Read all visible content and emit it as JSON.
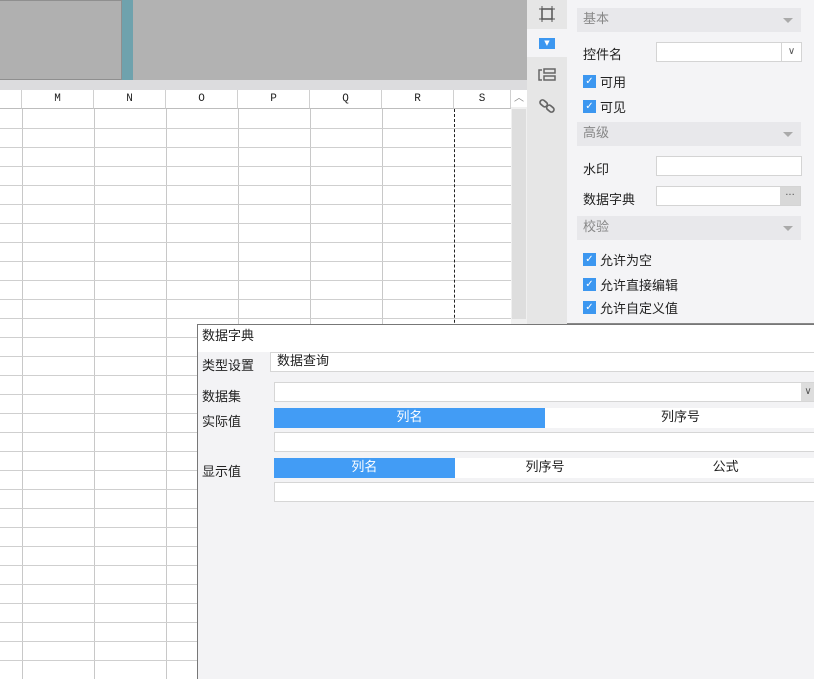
{
  "grid": {
    "columns": [
      "M",
      "N",
      "O",
      "P",
      "Q",
      "R",
      "S"
    ]
  },
  "panel": {
    "sections": {
      "basic": "基本",
      "advanced": "高级",
      "validate": "校验"
    },
    "widget_name_label": "控件名",
    "widget_name_value": "",
    "enabled": "可用",
    "visible": "可见",
    "watermark_label": "水印",
    "watermark_value": "",
    "dict_label": "数据字典",
    "dict_value": "",
    "dict_button": "···",
    "allow_empty": "允许为空",
    "allow_edit": "允许直接编辑",
    "allow_custom": "允许自定义值"
  },
  "dialog": {
    "title": "数据字典",
    "type_label": "类型设置",
    "type_value": "数据查询",
    "dataset_label": "数据集",
    "dataset_value": "",
    "actual_label": "实际值",
    "actual_tabs": [
      "列名",
      "列序号"
    ],
    "actual_value": "",
    "display_label": "显示值",
    "display_tabs": [
      "列名",
      "列序号",
      "公式"
    ],
    "display_value": ""
  },
  "colors": {
    "accent": "#429cf5"
  }
}
